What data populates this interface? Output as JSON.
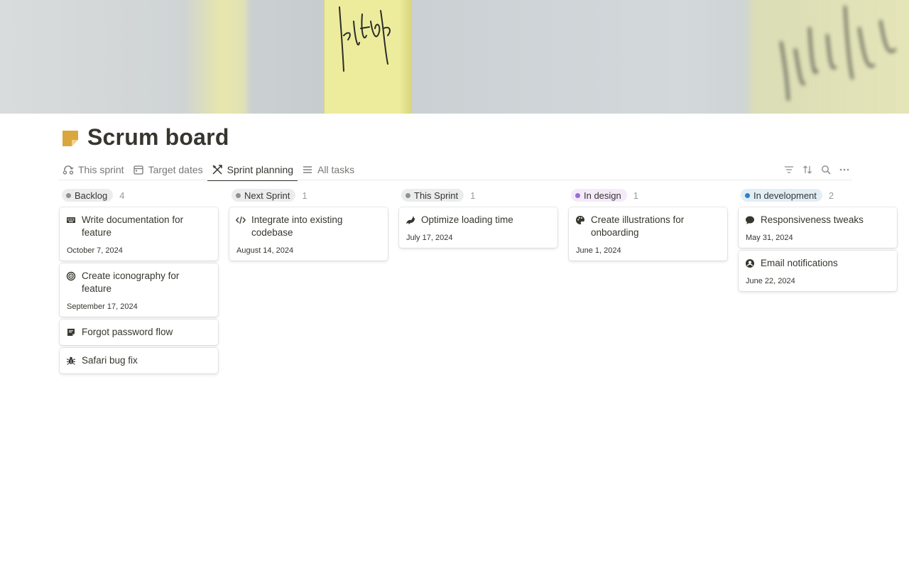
{
  "page": {
    "title": "Scrum board",
    "icon": "sticky-note-icon",
    "accent": "#d9a73e"
  },
  "tabs": [
    {
      "label": "This sprint",
      "icon": "sprint-loop-icon",
      "active": false
    },
    {
      "label": "Target dates",
      "icon": "calendar-icon",
      "active": false
    },
    {
      "label": "Sprint planning",
      "icon": "planning-icon",
      "active": true
    },
    {
      "label": "All tasks",
      "icon": "list-icon",
      "active": false
    }
  ],
  "toolbar": [
    "filter-icon",
    "sort-icon",
    "search-icon",
    "more-icon"
  ],
  "columns": [
    {
      "label": "Backlog",
      "count": "4",
      "pill_bg": "#ebeced",
      "dot": "#91918e",
      "cards": [
        {
          "title": "Write documentation for feature",
          "icon": "keyboard-icon",
          "date": "October 7, 2024"
        },
        {
          "title": "Create iconography for feature",
          "icon": "target-icon",
          "date": "September 17, 2024"
        },
        {
          "title": "Forgot password flow",
          "icon": "note-icon",
          "date": ""
        },
        {
          "title": "Safari bug fix",
          "icon": "bug-icon",
          "date": ""
        }
      ]
    },
    {
      "label": "Next Sprint",
      "count": "1",
      "pill_bg": "#ebeced",
      "dot": "#91918e",
      "cards": [
        {
          "title": "Integrate into existing codebase",
          "icon": "code-icon",
          "date": "August 14, 2024"
        }
      ]
    },
    {
      "label": "This Sprint",
      "count": "1",
      "pill_bg": "#ebeced",
      "dot": "#91918e",
      "cards": [
        {
          "title": "Optimize loading time",
          "icon": "rabbit-icon",
          "date": "July 17, 2024"
        }
      ]
    },
    {
      "label": "In design",
      "count": "1",
      "pill_bg": "#f4eafa",
      "dot": "#9a6dd7",
      "cards": [
        {
          "title": "Create illustrations for onboarding",
          "icon": "palette-icon",
          "date": "June 1, 2024"
        }
      ]
    },
    {
      "label": "In development",
      "count": "2",
      "pill_bg": "#e1eef8",
      "dot": "#2f80c4",
      "cards": [
        {
          "title": "Responsiveness tweaks",
          "icon": "chat-bubble-icon",
          "date": "May 31, 2024"
        },
        {
          "title": "Email notifications",
          "icon": "user-circle-icon",
          "date": "June 22, 2024"
        }
      ]
    }
  ]
}
